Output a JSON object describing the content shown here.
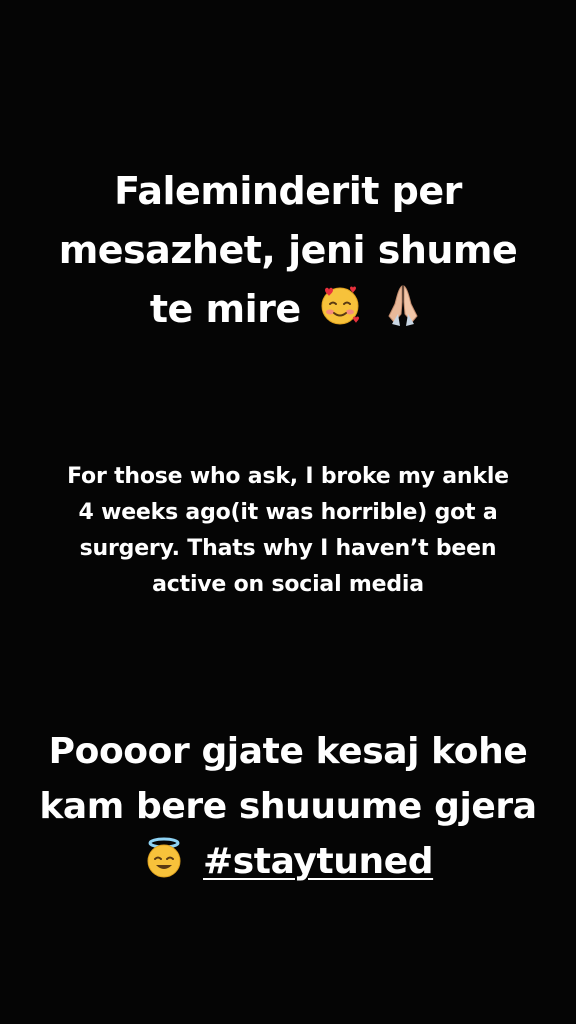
{
  "story": {
    "block1": {
      "line1": "Faleminderit per",
      "line2": "mesazhet, jeni shume",
      "line3": "te mire",
      "emojis": [
        "smiling-face-with-hearts",
        "folded-hands"
      ]
    },
    "block2": {
      "line1": "For those who ask, I broke my ankle",
      "line2": "4 weeks ago(it was horrible) got a",
      "line3": "surgery. Thats why I haven’t been",
      "line4": "active on social media"
    },
    "block3": {
      "line1": "Poooor gjate kesaj kohe",
      "line2": "kam bere shuuume gjera",
      "emoji": "smiling-face-with-halo",
      "hashtag": "#staytuned"
    }
  }
}
